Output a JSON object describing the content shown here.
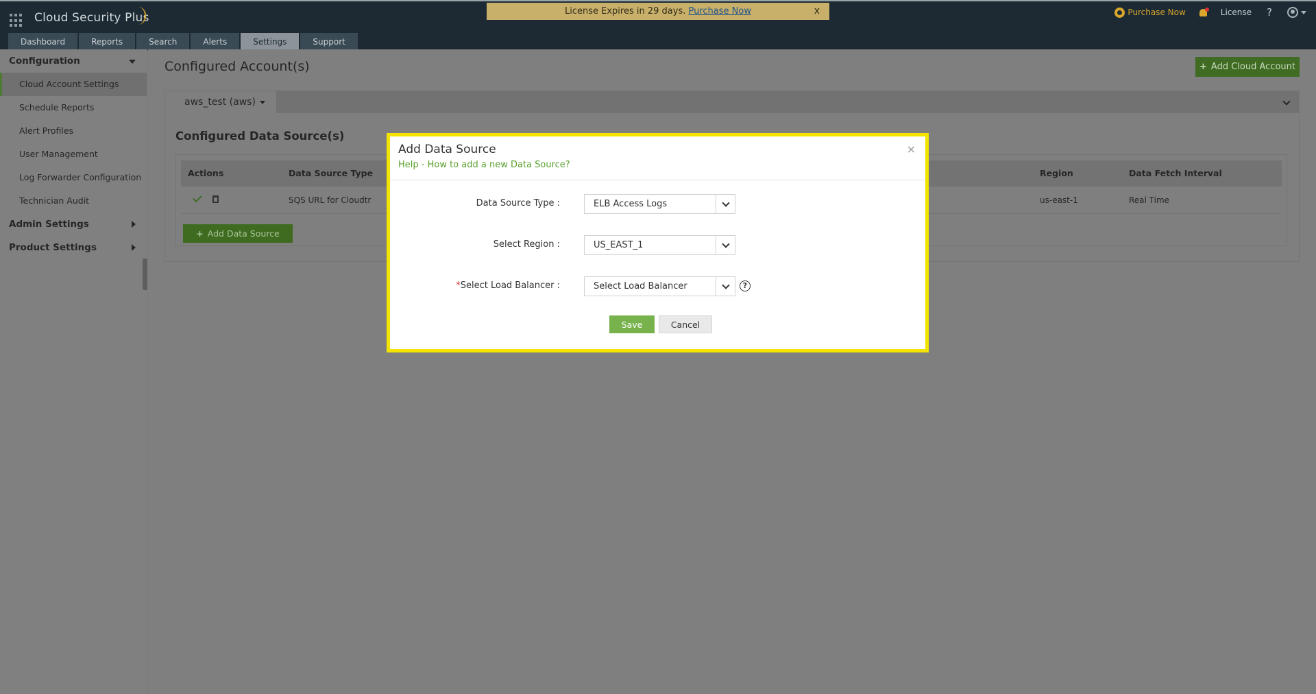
{
  "app": {
    "brand": "Cloud Security Plus",
    "license_banner": {
      "text": "License Expires in 29 days.",
      "link": "Purchase Now",
      "close": "x"
    },
    "top_right": {
      "purchase": "Purchase Now",
      "license": "License",
      "help": "?"
    },
    "tabs": [
      "Dashboard",
      "Reports",
      "Search",
      "Alerts",
      "Settings",
      "Support"
    ],
    "active_tab": "Settings"
  },
  "sidebar": {
    "configuration": "Configuration",
    "items": [
      "Cloud Account Settings",
      "Schedule Reports",
      "Alert Profiles",
      "User Management",
      "Log Forwarder Configuration",
      "Technician Audit"
    ],
    "admin_settings": "Admin Settings",
    "product_settings": "Product Settings"
  },
  "main": {
    "title": "Configured Account(s)",
    "add_cloud_account": "Add Cloud Account",
    "account_tab": "aws_test (aws)",
    "datasources_title": "Configured Data Source(s)",
    "table": {
      "headers": {
        "actions": "Actions",
        "type": "Data Source Type",
        "region": "Region",
        "interval": "Data Fetch Interval"
      },
      "row": {
        "type": "SQS URL for Cloudtr",
        "region": "us-east-1",
        "interval": "Real Time"
      }
    },
    "add_data_source": "Add Data Source"
  },
  "modal": {
    "title": "Add Data Source",
    "help": "Help - How to add a new Data Source?",
    "close": "×",
    "fields": {
      "type_label": "Data Source Type :",
      "type_value": "ELB Access Logs",
      "region_label": "Select Region :",
      "region_value": "US_EAST_1",
      "lb_required": "*",
      "lb_label": "Select Load Balancer :",
      "lb_value": "Select Load Balancer"
    },
    "help_icon": "?",
    "save": "Save",
    "cancel": "Cancel"
  },
  "colors": {
    "accent_green": "#77b24c",
    "dark_green": "#3f6b22",
    "header": "#1d2a33",
    "highlight": "#f2e400"
  }
}
